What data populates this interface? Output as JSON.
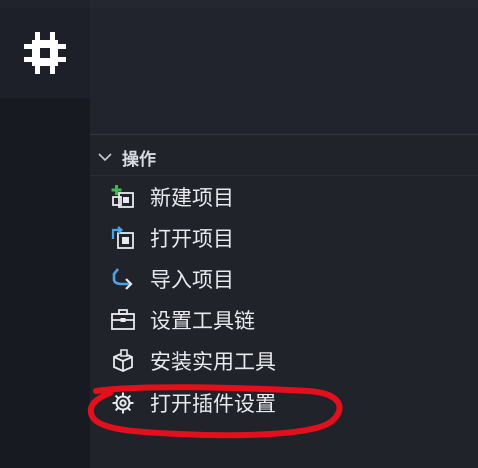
{
  "sidebar": {
    "active_icon": "chip-icon"
  },
  "section": {
    "title": "操作",
    "expanded": true
  },
  "actions": [
    {
      "label": "新建项目",
      "icon": "new-project-icon"
    },
    {
      "label": "打开项目",
      "icon": "open-project-icon"
    },
    {
      "label": "导入项目",
      "icon": "import-project-icon"
    },
    {
      "label": "设置工具链",
      "icon": "toolbox-icon"
    },
    {
      "label": "安装实用工具",
      "icon": "install-utility-icon"
    },
    {
      "label": "打开插件设置",
      "icon": "gear-icon"
    }
  ],
  "colors": {
    "text": "#e8eaee",
    "accent_blue": "#4aa3e8",
    "annotation_red": "#e2101d"
  }
}
